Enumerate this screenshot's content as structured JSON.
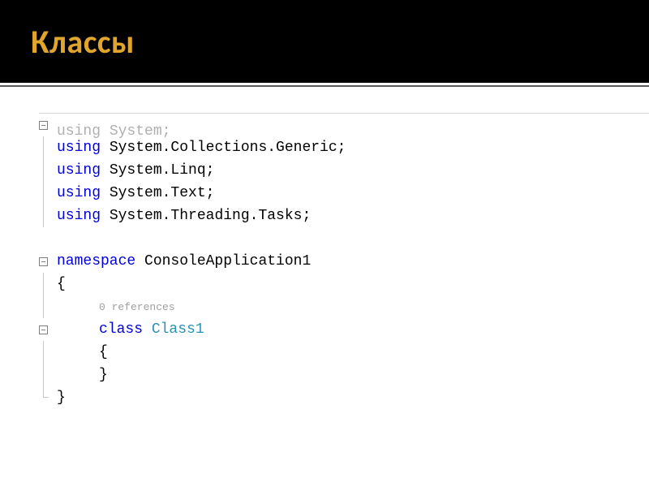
{
  "slide": {
    "title": "Классы"
  },
  "code": {
    "line1_kw": "using",
    "line1_rest": " System;",
    "line2_kw": "using",
    "line2_rest": " System.Collections.Generic;",
    "line3_kw": "using",
    "line3_rest": " System.Linq;",
    "line4_kw": "using",
    "line4_rest": " System.Text;",
    "line5_kw": "using",
    "line5_rest": " System.Threading.Tasks;",
    "line7_kw": "namespace",
    "line7_rest": " ConsoleApplication1",
    "brace_open": "{",
    "brace_close": "}",
    "references": "0 references",
    "class_kw": "class",
    "class_name": " Class1"
  }
}
